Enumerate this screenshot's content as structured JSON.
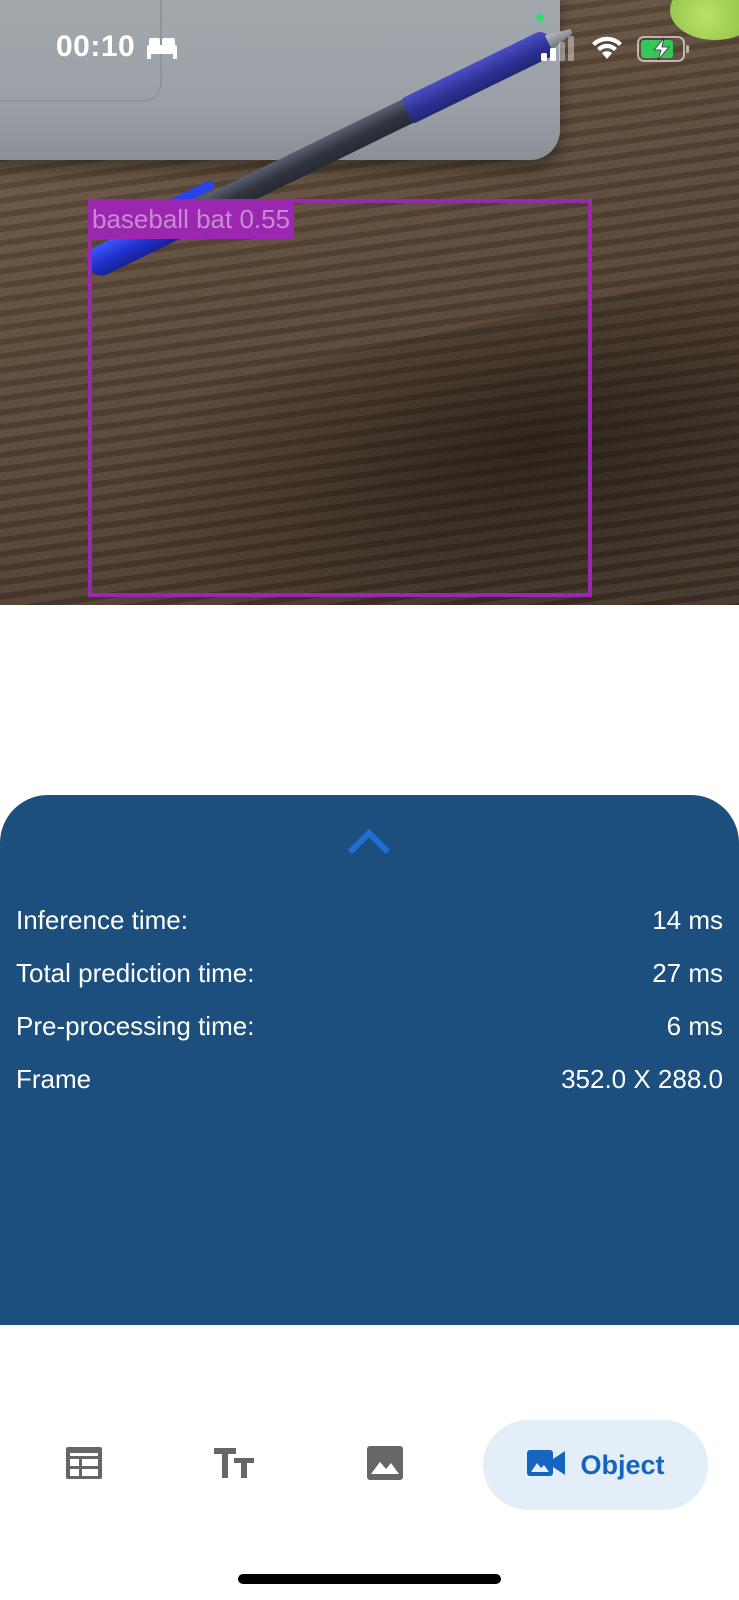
{
  "status_bar": {
    "time": "00:10",
    "icons": [
      "bed-icon",
      "signal-icon",
      "wifi-icon",
      "battery-charging-icon"
    ]
  },
  "camera": {
    "detection": {
      "label": "baseball bat 0.55",
      "color": "#9b27b0"
    }
  },
  "panel": {
    "background": "#1c4f7e",
    "chevron_icon": "chevron-up-icon",
    "rows": [
      {
        "label": "Inference time:",
        "value": "14 ms"
      },
      {
        "label": "Total prediction time:",
        "value": "27 ms"
      },
      {
        "label": "Pre-processing time:",
        "value": "6 ms"
      },
      {
        "label": "Frame",
        "value": "352.0 X 288.0"
      }
    ]
  },
  "bottom_nav": {
    "accent": "#1565c0",
    "items": [
      {
        "icon": "table-icon"
      },
      {
        "icon": "text-icon"
      },
      {
        "icon": "image-icon"
      },
      {
        "icon": "videocam-icon",
        "label": "Object",
        "active": true
      }
    ]
  }
}
